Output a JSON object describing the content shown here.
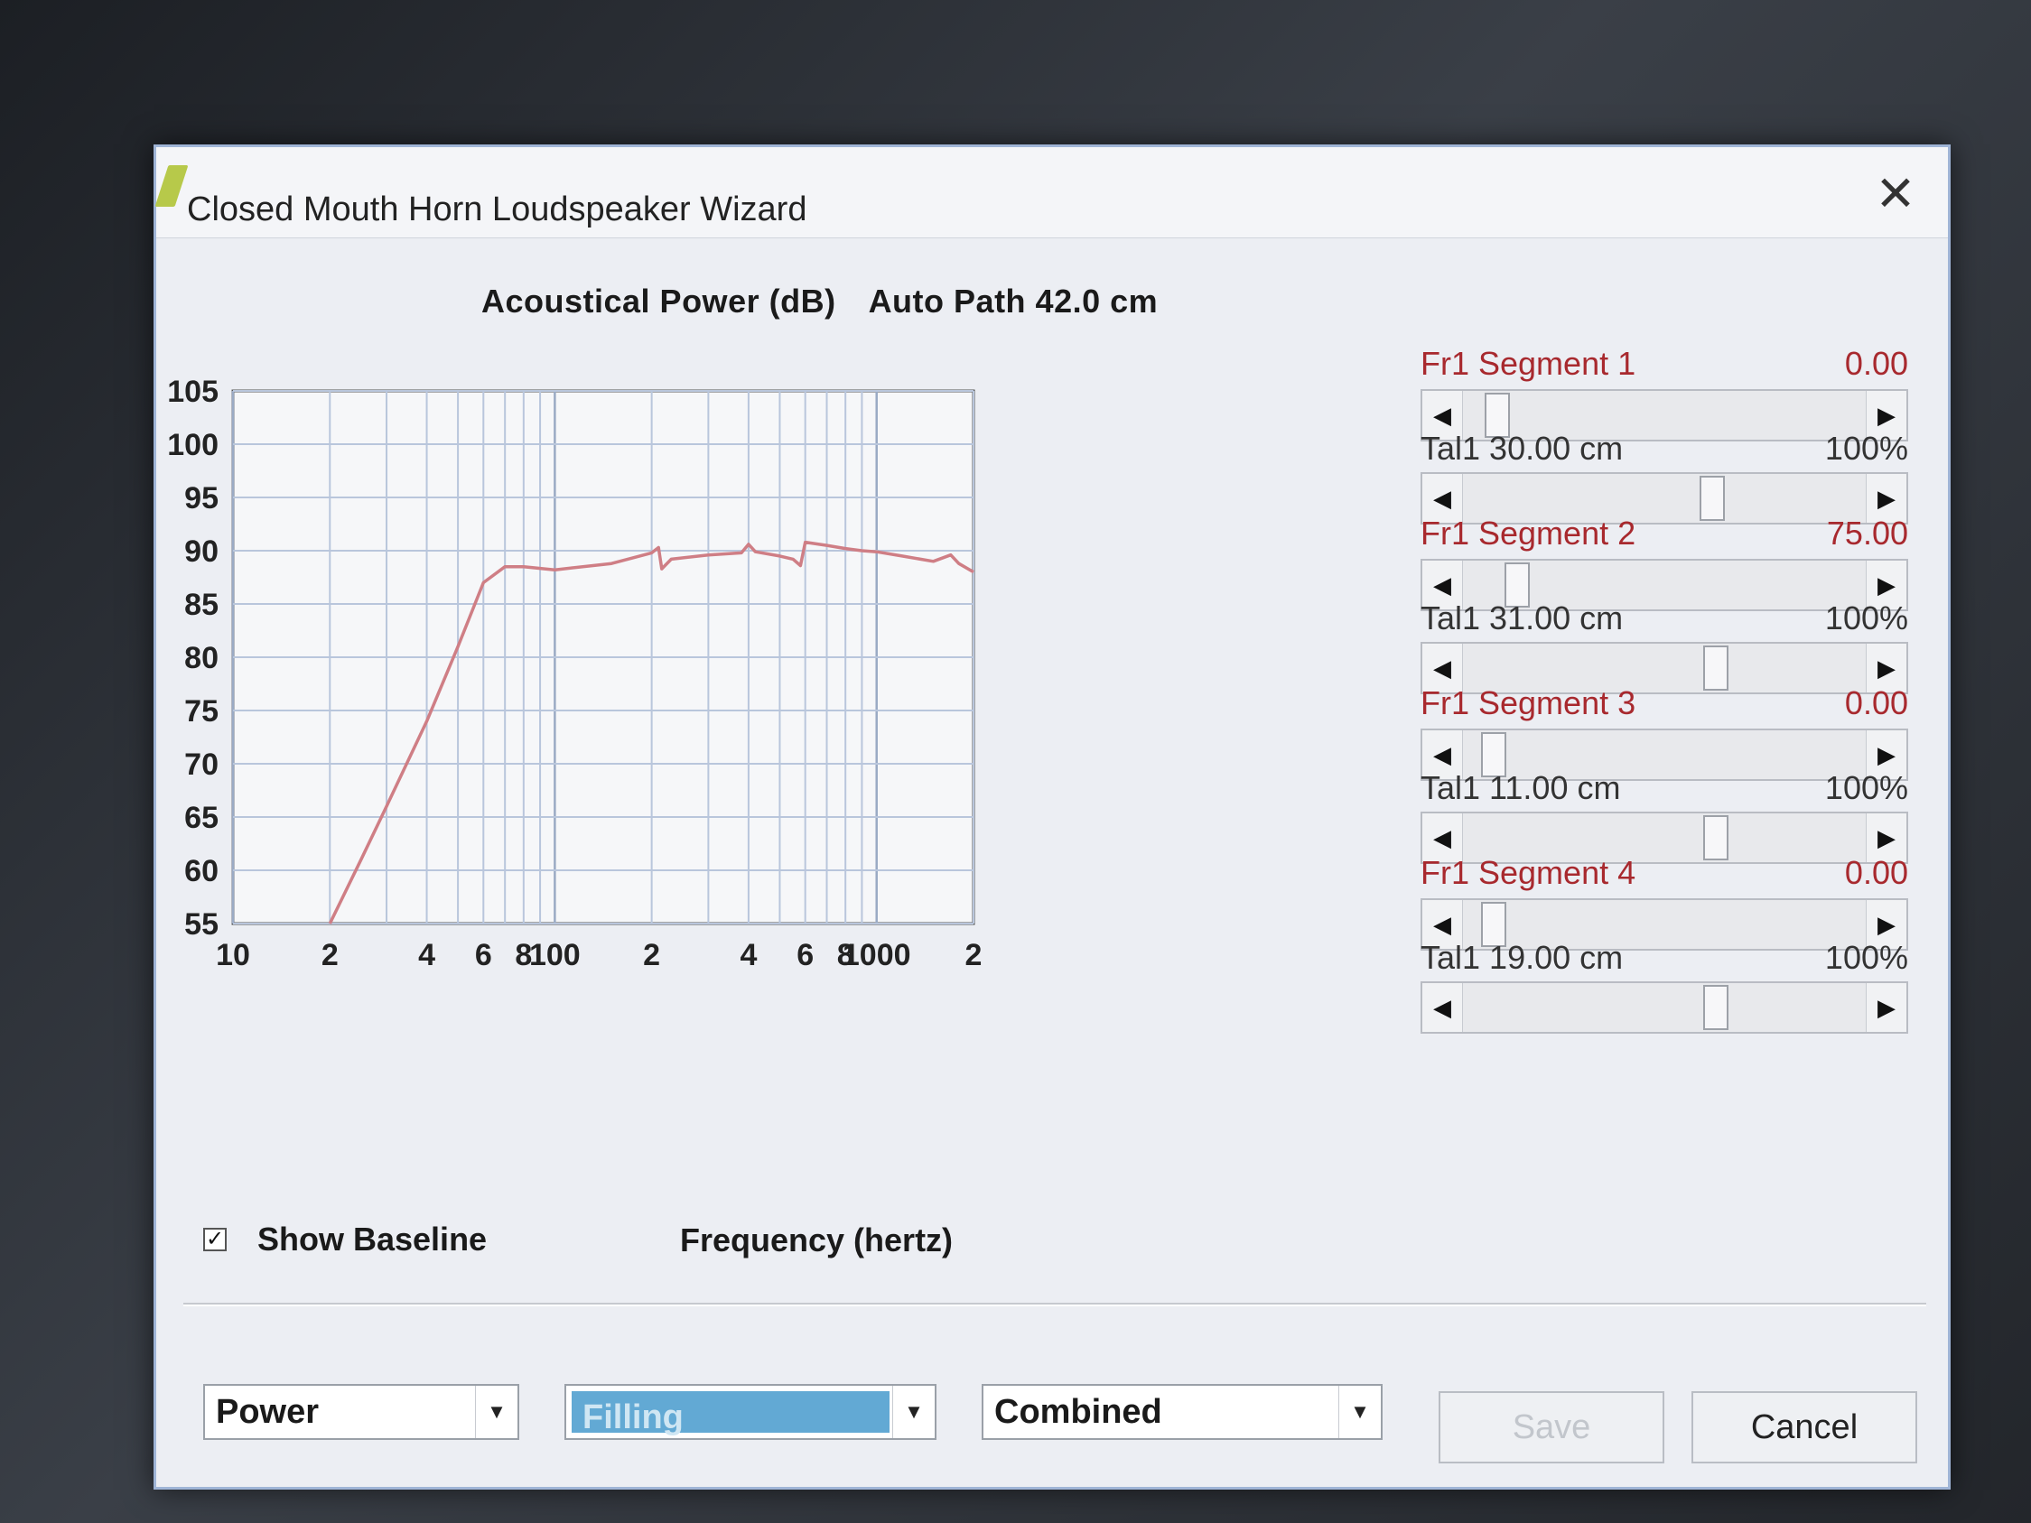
{
  "window": {
    "title": "Closed Mouth Horn Loudspeaker Wizard",
    "close_glyph": "✕"
  },
  "chart_header": {
    "label": "Acoustical Power (dB)",
    "path": "Auto Path 42.0 cm"
  },
  "chart_data": {
    "type": "line",
    "title": "Acoustical Power (dB)   Auto Path 42.0 cm",
    "xlabel": "Frequency (hertz)",
    "ylabel": "",
    "x_scale": "log",
    "xlim": [
      10,
      2000
    ],
    "ylim": [
      55,
      105
    ],
    "grid": true,
    "y_ticks": [
      105,
      100,
      95,
      90,
      85,
      80,
      75,
      70,
      65,
      60,
      55
    ],
    "x_ticks": [
      {
        "value": 10,
        "label": "10"
      },
      {
        "value": 20,
        "label": "2"
      },
      {
        "value": 40,
        "label": "4"
      },
      {
        "value": 60,
        "label": "6"
      },
      {
        "value": 80,
        "label": "8"
      },
      {
        "value": 100,
        "label": "100"
      },
      {
        "value": 200,
        "label": "2"
      },
      {
        "value": 400,
        "label": "4"
      },
      {
        "value": 600,
        "label": "6"
      },
      {
        "value": 800,
        "label": "8"
      },
      {
        "value": 1000,
        "label": "1000"
      },
      {
        "value": 2000,
        "label": "2"
      }
    ],
    "series": [
      {
        "color": "#cf7e85",
        "x": [
          20,
          25,
          30,
          40,
          50,
          60,
          70,
          80,
          100,
          150,
          200,
          210,
          215,
          230,
          300,
          380,
          400,
          420,
          500,
          550,
          580,
          600,
          700,
          800,
          900,
          1000,
          1200,
          1500,
          1700,
          1800,
          2000
        ],
        "y": [
          55,
          61,
          66,
          74,
          81,
          87,
          88.5,
          88.5,
          88.2,
          88.8,
          89.8,
          90.3,
          88.3,
          89.2,
          89.6,
          89.8,
          90.6,
          89.9,
          89.5,
          89.2,
          88.6,
          90.8,
          90.5,
          90.2,
          90.0,
          89.9,
          89.5,
          89.0,
          89.6,
          88.8,
          88.0
        ]
      }
    ]
  },
  "baseline": {
    "checked_glyph": "✓",
    "label": "Show Baseline"
  },
  "right_panel": {
    "segments": [
      {
        "fr_label": "Fr1  Segment 1",
        "fr_value": "0.00",
        "fr_pos": 0.06,
        "tal_label": "Tal1  30.00 cm",
        "tal_value": "100%",
        "tal_pos": 0.62
      },
      {
        "fr_label": "Fr1  Segment 2",
        "fr_value": "75.00",
        "fr_pos": 0.11,
        "tal_label": "Tal1  31.00 cm",
        "tal_value": "100%",
        "tal_pos": 0.63
      },
      {
        "fr_label": "Fr1  Segment 3",
        "fr_value": "0.00",
        "fr_pos": 0.05,
        "tal_label": "Tal1  11.00 cm",
        "tal_value": "100%",
        "tal_pos": 0.63
      },
      {
        "fr_label": "Fr1  Segment 4",
        "fr_value": "0.00",
        "fr_pos": 0.05,
        "tal_label": "Tal1  19.00 cm",
        "tal_value": "100%",
        "tal_pos": 0.63
      }
    ],
    "arrow_left": "◀",
    "arrow_right": "▶"
  },
  "footer": {
    "combo_power": "Power",
    "combo_filling": "Filling",
    "combo_combined": "Combined",
    "combo_arrow": "▼",
    "save_label": "Save",
    "cancel_label": "Cancel"
  }
}
